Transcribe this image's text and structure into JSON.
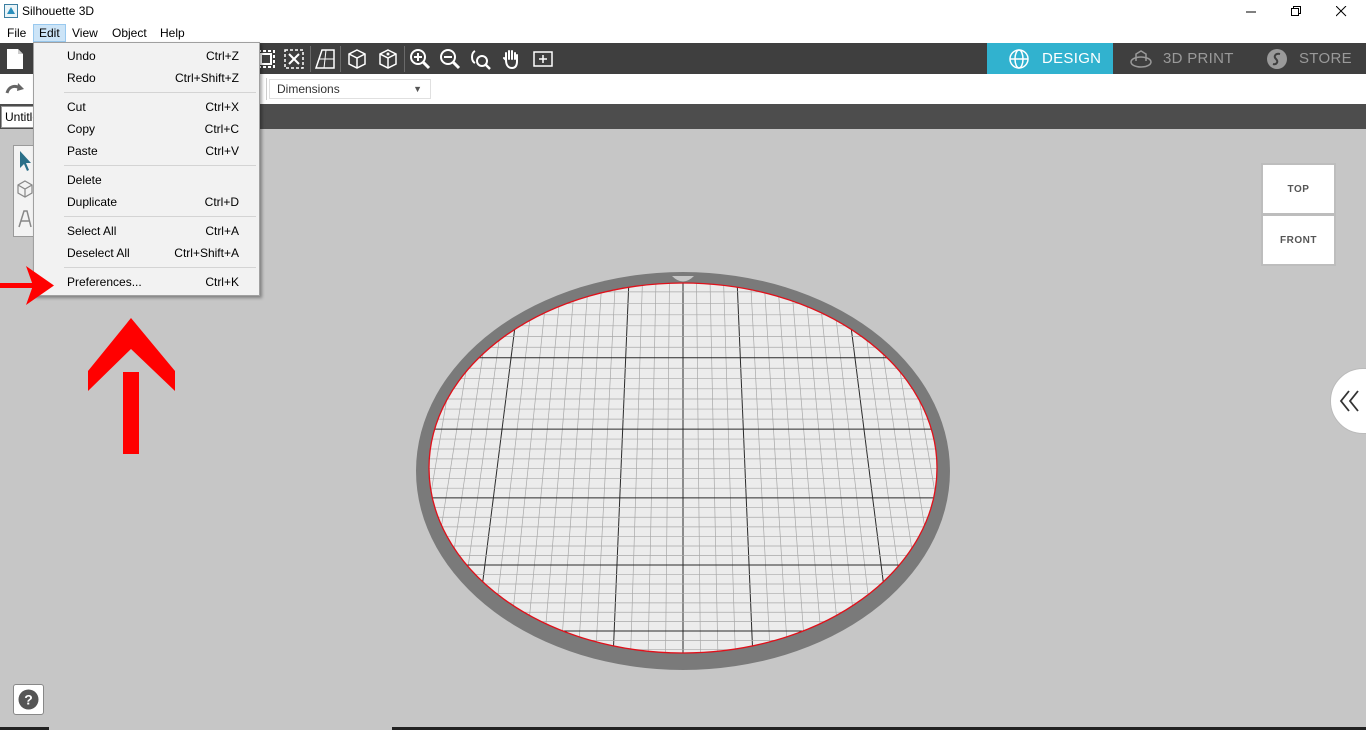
{
  "window": {
    "title": "Silhouette 3D",
    "controls": [
      "minimize",
      "restore",
      "close"
    ]
  },
  "menubar": {
    "items": [
      "File",
      "Edit",
      "View",
      "Object",
      "Help"
    ],
    "active": "Edit"
  },
  "edit_menu": {
    "groups": [
      [
        {
          "label": "Undo",
          "shortcut": "Ctrl+Z"
        },
        {
          "label": "Redo",
          "shortcut": "Ctrl+Shift+Z"
        }
      ],
      [
        {
          "label": "Cut",
          "shortcut": "Ctrl+X"
        },
        {
          "label": "Copy",
          "shortcut": "Ctrl+C"
        },
        {
          "label": "Paste",
          "shortcut": "Ctrl+V"
        }
      ],
      [
        {
          "label": "Delete",
          "shortcut": ""
        },
        {
          "label": "Duplicate",
          "shortcut": "Ctrl+D"
        }
      ],
      [
        {
          "label": "Select All",
          "shortcut": "Ctrl+A"
        },
        {
          "label": "Deselect All",
          "shortcut": "Ctrl+Shift+A"
        }
      ],
      [
        {
          "label": "Preferences...",
          "shortcut": "Ctrl+K"
        }
      ]
    ]
  },
  "toolbar": {
    "icons": [
      "new-document-icon",
      "group-icon",
      "ungroup-icon",
      "perspective-icon",
      "cube-outline-icon",
      "cube-solid-icon",
      "zoom-in-icon",
      "zoom-out-icon",
      "zoom-fit-icon",
      "pan-hand-icon",
      "add-box-icon"
    ]
  },
  "modes": {
    "design": "DESIGN",
    "print3d": "3D PRINT",
    "store": "STORE",
    "active": "design",
    "active_color": "#31b2cf"
  },
  "options": {
    "dimensions_label": "Dimensions"
  },
  "document": {
    "tab_label": "Untitled"
  },
  "view_cube": {
    "top": "TOP",
    "front": "FRONT"
  },
  "colors": {
    "accent": "#31b2cf",
    "annotation_arrow": "#ff0000",
    "bed_outline": "#e0101a"
  }
}
